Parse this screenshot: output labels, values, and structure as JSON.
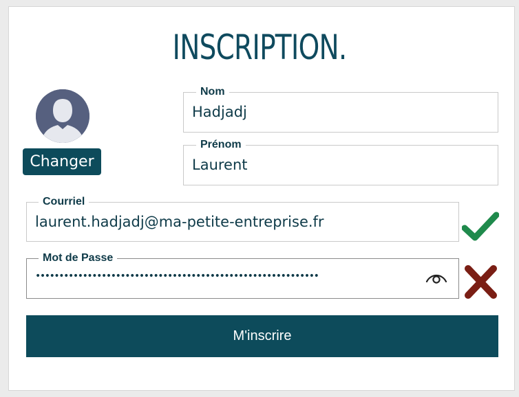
{
  "form": {
    "title": "INSCRIPTION.",
    "avatar": {
      "change_label": "Changer"
    },
    "fields": {
      "nom": {
        "label": "Nom",
        "value": "Hadjadj"
      },
      "prenom": {
        "label": "Prénom",
        "value": "Laurent"
      },
      "courriel": {
        "label": "Courriel",
        "value": "laurent.hadjadj@ma-petite-entreprise.fr",
        "status": "valid"
      },
      "mot_de_passe": {
        "label": "Mot de Passe",
        "value": "••••••••••••••••••••••••••••••••••••••••••••••••••••••••••••",
        "status": "invalid"
      }
    },
    "submit_label": "M'inscrire"
  },
  "icons": {
    "avatar": "user-silhouette-icon",
    "show_password": "eye-icon",
    "email_status": "check-icon",
    "password_status": "cross-icon"
  },
  "colors": {
    "primary": "#0d4b5b",
    "valid": "#1f8a4c",
    "invalid": "#7a1e14"
  }
}
